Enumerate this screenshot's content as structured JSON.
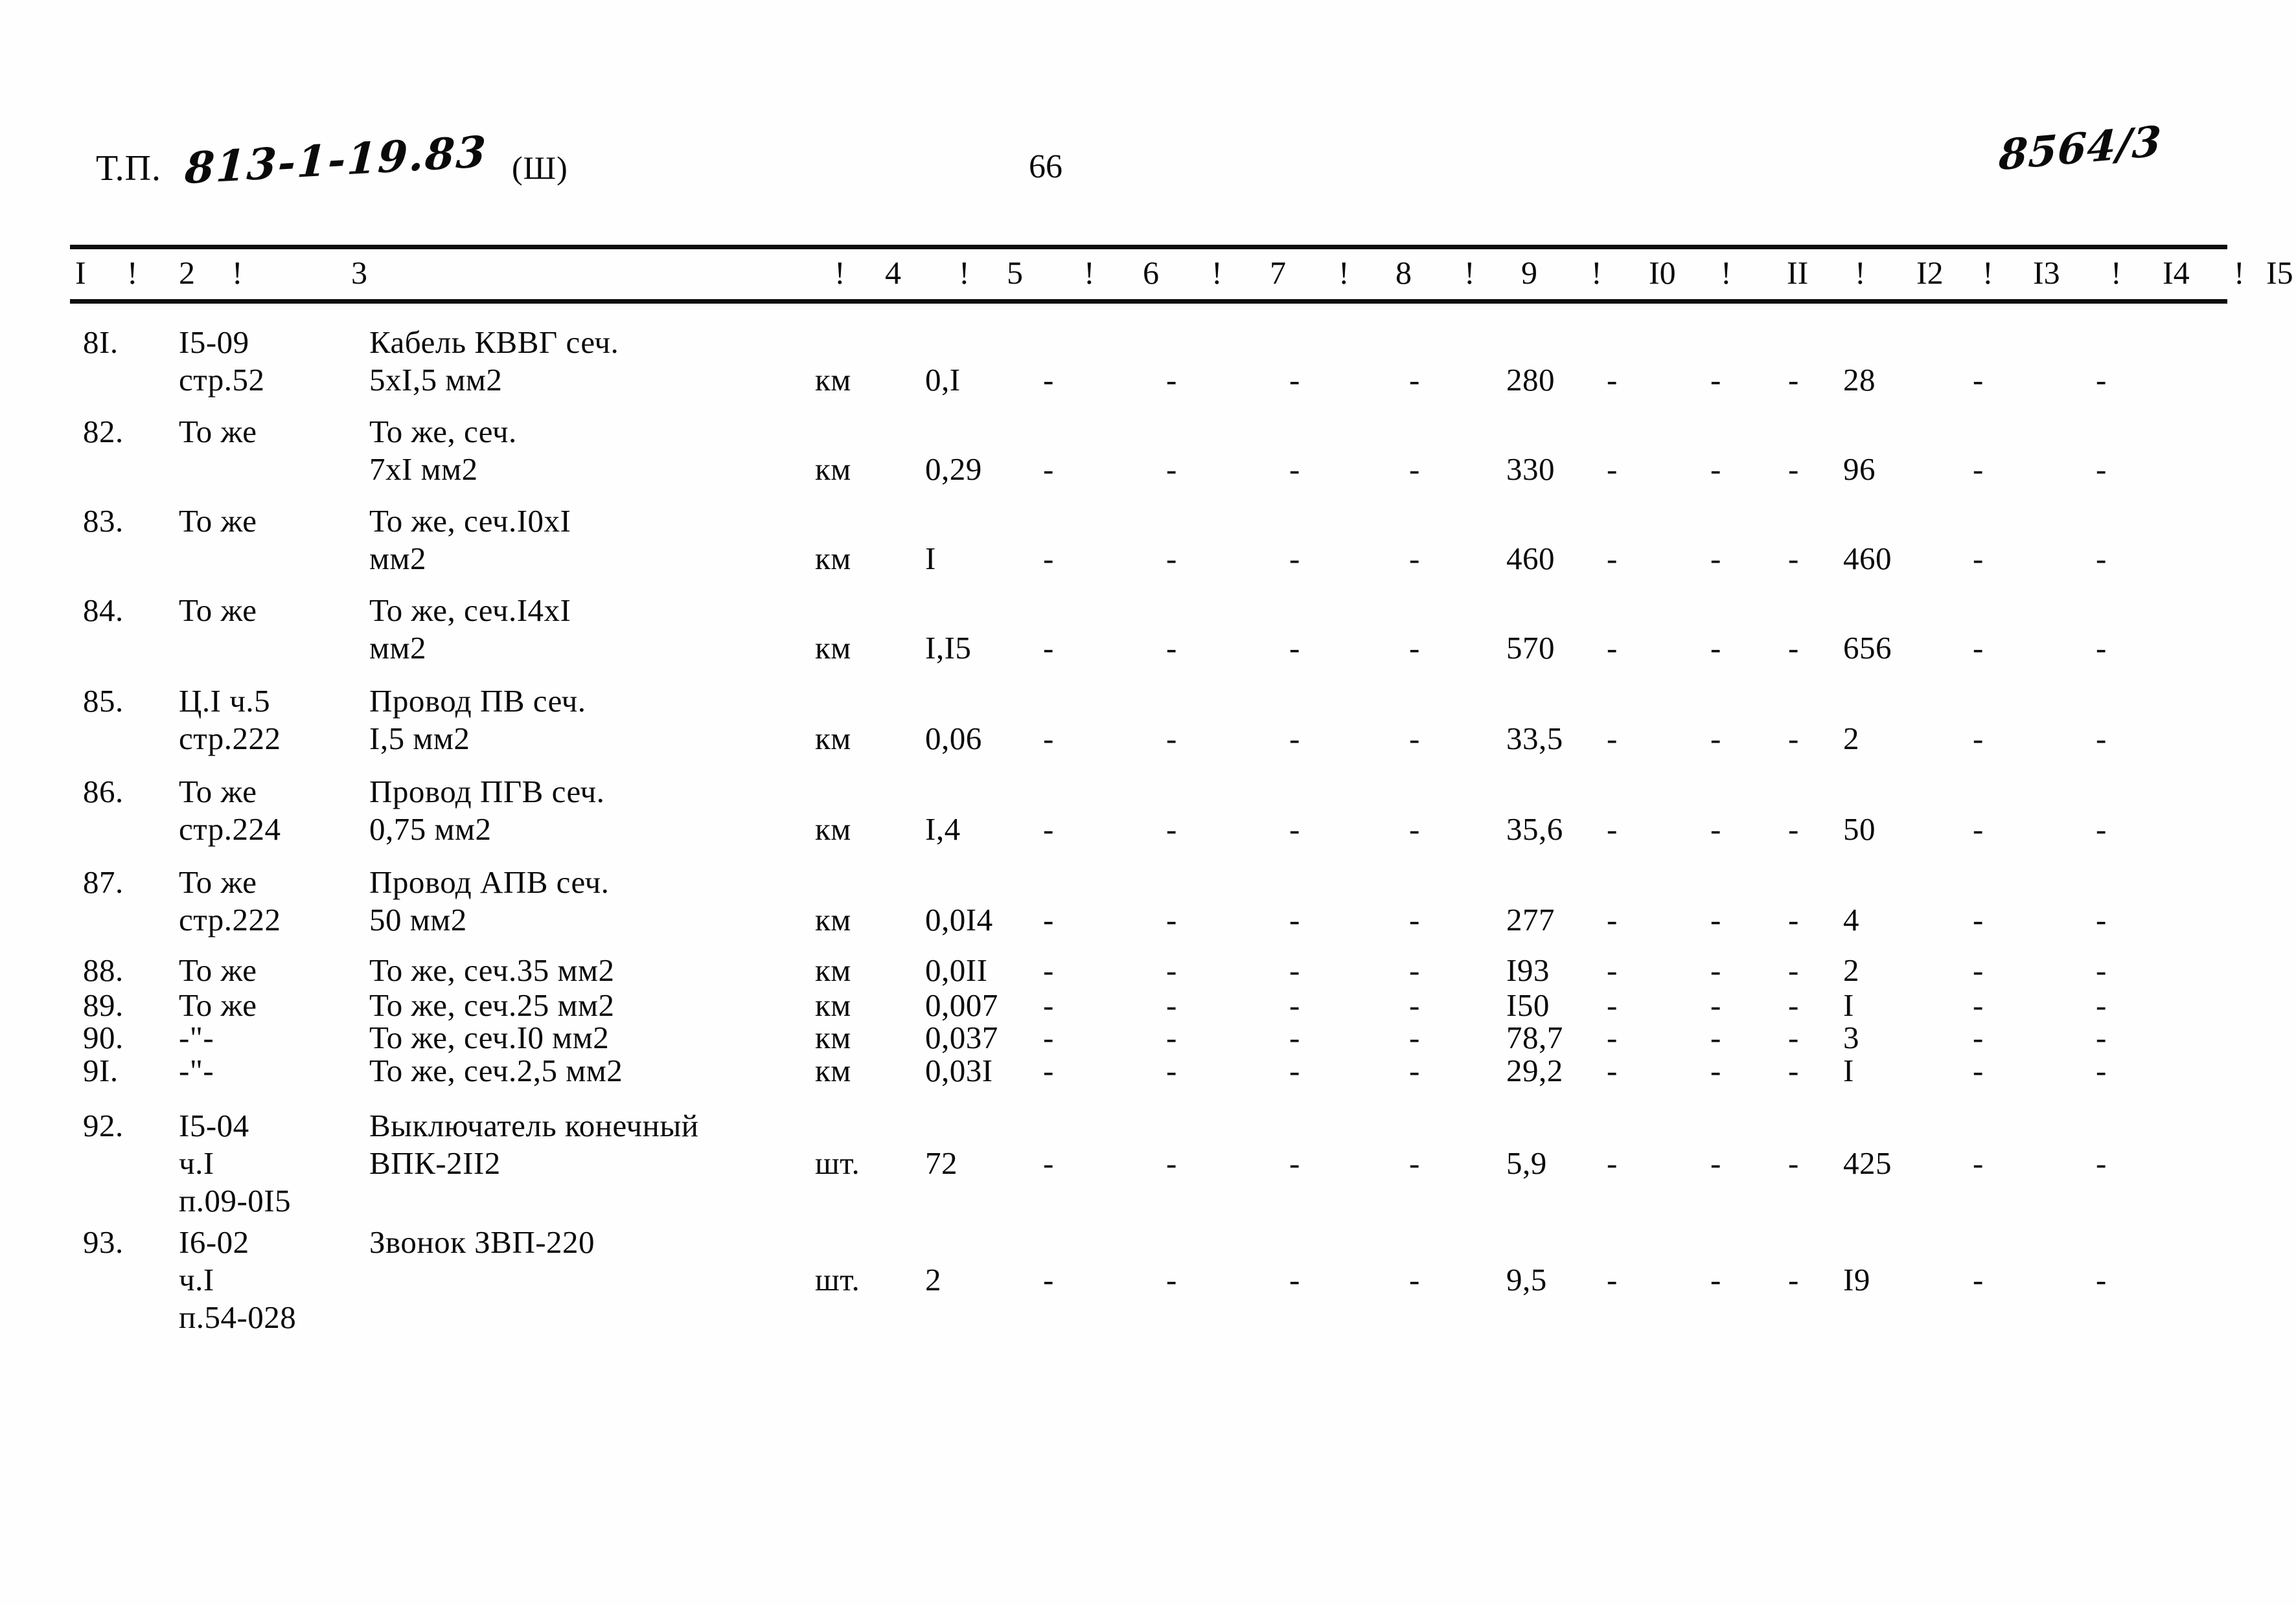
{
  "header": {
    "tp_label": "Т.П.",
    "tp_code": "813-1-19.83",
    "series": "(Ш)",
    "page_number": "66",
    "stamp": "8564/3"
  },
  "table": {
    "column_headers": [
      "I",
      "2",
      "3",
      "4",
      "5",
      "6",
      "7",
      "8",
      "9",
      "I0",
      "II",
      "I2",
      "I3",
      "I4",
      "I5"
    ],
    "separator": "!",
    "rows": [
      {
        "num": "8I.",
        "code_lines": [
          "I5-09",
          "стр.52"
        ],
        "name_lines": [
          "Кабель КВВГ сеч.",
          "5хI,5 мм2"
        ],
        "unit": "км",
        "c4": "0,I",
        "c5": "-",
        "c6": "-",
        "c7": "-",
        "c8": "-",
        "c9": "280",
        "c10": "-",
        "c11": "-",
        "c12": "-",
        "c13": "28",
        "c14": "-",
        "c15": "-"
      },
      {
        "num": "82.",
        "code_lines": [
          "То же"
        ],
        "name_lines": [
          "То же, сеч.",
          "7хI мм2"
        ],
        "unit": "км",
        "c4": "0,29",
        "c5": "-",
        "c6": "-",
        "c7": "-",
        "c8": "-",
        "c9": "330",
        "c10": "-",
        "c11": "-",
        "c12": "-",
        "c13": "96",
        "c14": "-",
        "c15": "-"
      },
      {
        "num": "83.",
        "code_lines": [
          "То же"
        ],
        "name_lines": [
          "То же, сеч.I0хI",
          "мм2"
        ],
        "unit": "км",
        "c4": "I",
        "c5": "-",
        "c6": "-",
        "c7": "-",
        "c8": "-",
        "c9": "460",
        "c10": "-",
        "c11": "-",
        "c12": "-",
        "c13": "460",
        "c14": "-",
        "c15": "-"
      },
      {
        "num": "84.",
        "code_lines": [
          "То же"
        ],
        "name_lines": [
          "То же, сеч.I4хI",
          "мм2"
        ],
        "unit": "км",
        "c4": "I,I5",
        "c5": "-",
        "c6": "-",
        "c7": "-",
        "c8": "-",
        "c9": "570",
        "c10": "-",
        "c11": "-",
        "c12": "-",
        "c13": "656",
        "c14": "-",
        "c15": "-"
      },
      {
        "num": "85.",
        "code_lines": [
          "Ц.I ч.5",
          "стр.222"
        ],
        "name_lines": [
          "Провод ПВ сеч.",
          "I,5 мм2"
        ],
        "unit": "км",
        "c4": "0,06",
        "c5": "-",
        "c6": "-",
        "c7": "-",
        "c8": "-",
        "c9": "33,5",
        "c10": "-",
        "c11": "-",
        "c12": "-",
        "c13": "2",
        "c14": "-",
        "c15": "-"
      },
      {
        "num": "86.",
        "code_lines": [
          "То же",
          "стр.224"
        ],
        "name_lines": [
          "Провод ПГВ сеч.",
          "0,75 мм2"
        ],
        "unit": "км",
        "c4": "I,4",
        "c5": "-",
        "c6": "-",
        "c7": "-",
        "c8": "-",
        "c9": "35,6",
        "c10": "-",
        "c11": "-",
        "c12": "-",
        "c13": "50",
        "c14": "-",
        "c15": "-"
      },
      {
        "num": "87.",
        "code_lines": [
          "То же",
          "стр.222"
        ],
        "name_lines": [
          "Провод АПВ сеч.",
          "50 мм2"
        ],
        "unit": "км",
        "c4": "0,0I4",
        "c5": "-",
        "c6": "-",
        "c7": "-",
        "c8": "-",
        "c9": "277",
        "c10": "-",
        "c11": "-",
        "c12": "-",
        "c13": "4",
        "c14": "-",
        "c15": "-"
      },
      {
        "num": "88.",
        "code_lines": [
          "То же"
        ],
        "name_lines": [
          "То же, сеч.35 мм2"
        ],
        "unit": "км",
        "c4": "0,0II",
        "c5": "-",
        "c6": "-",
        "c7": "-",
        "c8": "-",
        "c9": "I93",
        "c10": "-",
        "c11": "-",
        "c12": "-",
        "c13": "2",
        "c14": "-",
        "c15": "-"
      },
      {
        "num": "89.",
        "code_lines": [
          "То же"
        ],
        "name_lines": [
          "То же, сеч.25 мм2"
        ],
        "unit": "км",
        "c4": "0,007",
        "c5": "-",
        "c6": "-",
        "c7": "-",
        "c8": "-",
        "c9": "I50",
        "c10": "-",
        "c11": "-",
        "c12": "-",
        "c13": "I",
        "c14": "-",
        "c15": "-"
      },
      {
        "num": "90.",
        "code_lines": [
          "-\"-"
        ],
        "name_lines": [
          "То же, сеч.I0 мм2"
        ],
        "unit": "км",
        "c4": "0,037",
        "c5": "-",
        "c6": "-",
        "c7": "-",
        "c8": "-",
        "c9": "78,7",
        "c10": "-",
        "c11": "-",
        "c12": "-",
        "c13": "3",
        "c14": "-",
        "c15": "-"
      },
      {
        "num": "9I.",
        "code_lines": [
          "-\"-"
        ],
        "name_lines": [
          "То же, сеч.2,5 мм2"
        ],
        "unit": "км",
        "c4": "0,03I",
        "c5": "-",
        "c6": "-",
        "c7": "-",
        "c8": "-",
        "c9": "29,2",
        "c10": "-",
        "c11": "-",
        "c12": "-",
        "c13": "I",
        "c14": "-",
        "c15": "-"
      },
      {
        "num": "92.",
        "code_lines": [
          "I5-04",
          "ч.I",
          "п.09-0I5"
        ],
        "name_lines": [
          "Выключатель конечный",
          "ВПК-2II2"
        ],
        "unit": "шт.",
        "c4": "72",
        "c5": "-",
        "c6": "-",
        "c7": "-",
        "c8": "-",
        "c9": "5,9",
        "c10": "-",
        "c11": "-",
        "c12": "-",
        "c13": "425",
        "c14": "-",
        "c15": "-"
      },
      {
        "num": "93.",
        "code_lines": [
          "I6-02",
          "ч.I",
          "п.54-028"
        ],
        "name_lines": [
          "Звонок ЗВП-220"
        ],
        "unit": "шт.",
        "c4": "2",
        "c5": "-",
        "c6": "-",
        "c7": "-",
        "c8": "-",
        "c9": "9,5",
        "c10": "-",
        "c11": "-",
        "c12": "-",
        "c13": "I9",
        "c14": "-",
        "c15": "-"
      }
    ]
  }
}
